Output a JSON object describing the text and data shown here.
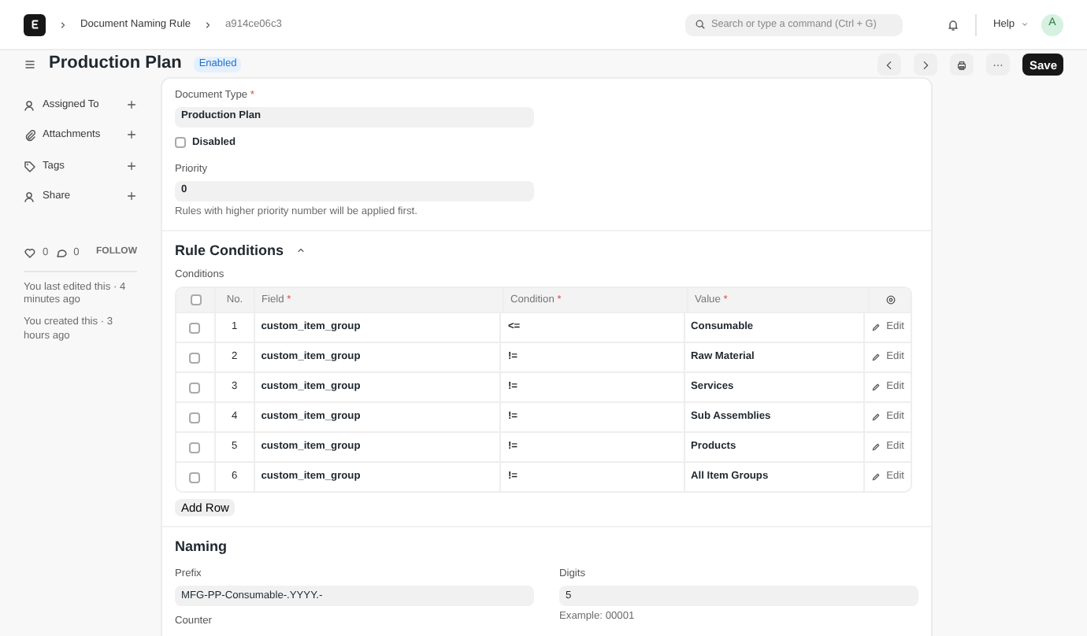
{
  "navbar": {
    "breadcrumbs": [
      "Document Naming Rule",
      "a914ce06c3"
    ],
    "search": {
      "placeholder": "Search or type a command (Ctrl + G)"
    },
    "help": "Help",
    "avatar": "A"
  },
  "page_header": {
    "title": "Production Plan",
    "status": "Enabled",
    "save": "Save"
  },
  "sidebar": {
    "items": [
      {
        "label": "Assigned To"
      },
      {
        "label": "Attachments"
      },
      {
        "label": "Tags"
      },
      {
        "label": "Share"
      }
    ],
    "likes": "0",
    "comments": "0",
    "follow": "FOLLOW",
    "activity": [
      "You last edited this · 4 minutes ago",
      "You created this · 3 hours ago"
    ]
  },
  "form": {
    "document_type": {
      "label": "Document Type",
      "required_mark": "*",
      "value": "Production Plan"
    },
    "disabled": {
      "label": "Disabled",
      "checked": false
    },
    "priority": {
      "label": "Priority",
      "value": "0",
      "help": "Rules with higher priority number will be applied first."
    },
    "rule_conditions": {
      "title": "Rule Conditions",
      "expanded": true,
      "label": "Conditions",
      "columns": [
        {
          "label": "No.",
          "required": false
        },
        {
          "label": "Field",
          "required": true
        },
        {
          "label": "Condition",
          "required": true
        },
        {
          "label": "Value",
          "required": true
        }
      ],
      "required_mark": "*",
      "all_selected": false,
      "rows": [
        {
          "no": "1",
          "field": "custom_item_group",
          "condition": "<=",
          "value": "Consumable",
          "edit": "Edit",
          "checked": false
        },
        {
          "no": "2",
          "field": "custom_item_group",
          "condition": "!=",
          "value": "Raw Material",
          "edit": "Edit",
          "checked": false
        },
        {
          "no": "3",
          "field": "custom_item_group",
          "condition": "!=",
          "value": "Services",
          "edit": "Edit",
          "checked": false
        },
        {
          "no": "4",
          "field": "custom_item_group",
          "condition": "!=",
          "value": "Sub Assemblies",
          "edit": "Edit",
          "checked": false
        },
        {
          "no": "5",
          "field": "custom_item_group",
          "condition": "!=",
          "value": "Products",
          "edit": "Edit",
          "checked": false
        },
        {
          "no": "6",
          "field": "custom_item_group",
          "condition": "!=",
          "value": "All Item Groups",
          "edit": "Edit",
          "checked": false
        }
      ],
      "add_row": "Add Row"
    },
    "naming": {
      "title": "Naming",
      "prefix": {
        "label": "Prefix",
        "value": "MFG-PP-Consumable-.YYYY.-"
      },
      "digits": {
        "label": "Digits",
        "value": "5",
        "help": "Example: 00001"
      },
      "counter": {
        "label": "Counter"
      }
    }
  }
}
